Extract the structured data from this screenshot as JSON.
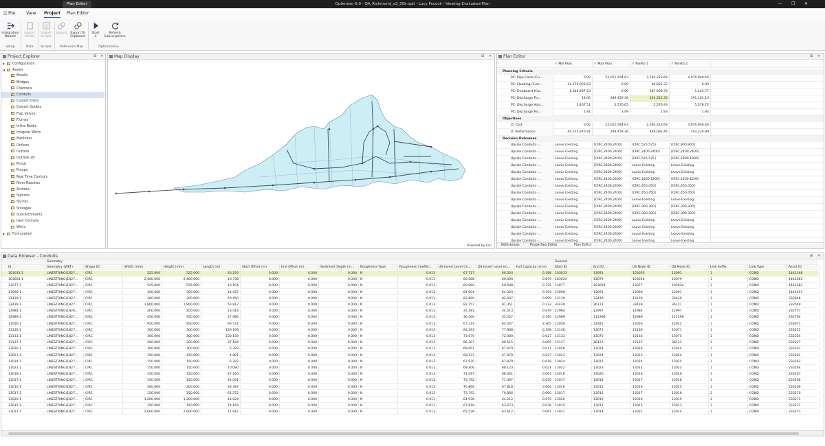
{
  "app": {
    "context_tab": "Plan Editor",
    "title": "Optimizer 6.0 - OA_Richmond_x3_50k.opti - Lucy Pocock - Viewing Evaluated Plan",
    "win_min": "—",
    "win_max": "❐",
    "win_close": "✕"
  },
  "menu": {
    "file": "File",
    "view": "View",
    "project": "Project",
    "plan_editor": "Plan Editor"
  },
  "ribbon": {
    "integration": "Integration\nModule",
    "import_model": "Import\nModel",
    "import_scripts": "Import\nScripts",
    "import": "Import",
    "export": "Export To\nClipboard",
    "start": "Start",
    "refresh": "Refresh\nSubscriptions",
    "groups": [
      "Setup",
      "Data",
      "Scripts",
      "Reference Map",
      "Optimization"
    ]
  },
  "explorer": {
    "title": "Project Explorer",
    "pin": "⊞",
    "close": "✕",
    "items": [
      {
        "label": "Configuration",
        "level": 0,
        "arrow": "▶"
      },
      {
        "label": "Assets",
        "level": 0,
        "arrow": "◢"
      },
      {
        "label": "Breaks",
        "level": 1
      },
      {
        "label": "Bridges",
        "level": 1
      },
      {
        "label": "Channels",
        "level": 1
      },
      {
        "label": "Conduits",
        "level": 1,
        "selected": true
      },
      {
        "label": "Culvert Inlets",
        "level": 1
      },
      {
        "label": "Culvert Outlets",
        "level": 1
      },
      {
        "label": "Flap Valves",
        "level": 1
      },
      {
        "label": "Flumes",
        "level": 1
      },
      {
        "label": "Inline Banks",
        "level": 1
      },
      {
        "label": "Irregular Weirs",
        "level": 1
      },
      {
        "label": "Manholes",
        "level": 1
      },
      {
        "label": "Orifices",
        "level": 1
      },
      {
        "label": "Outfalls",
        "level": 1
      },
      {
        "label": "Outfalls 2D",
        "level": 1
      },
      {
        "label": "Ponds",
        "level": 1
      },
      {
        "label": "Pumps",
        "level": 1
      },
      {
        "label": "Real Time Controls",
        "level": 1
      },
      {
        "label": "River Reaches",
        "level": 1
      },
      {
        "label": "Screens",
        "level": 1
      },
      {
        "label": "Siphons",
        "level": 1
      },
      {
        "label": "Sluices",
        "level": 1
      },
      {
        "label": "Storages",
        "level": 1
      },
      {
        "label": "Subcatchments",
        "level": 1
      },
      {
        "label": "User Controls",
        "level": 1
      },
      {
        "label": "Weirs",
        "level": 1
      },
      {
        "label": "Formulation",
        "level": 0,
        "arrow": "▶"
      }
    ]
  },
  "map": {
    "title": "Map Display",
    "credit": "Powered by Esri",
    "pin": "⊞",
    "close": "✕"
  },
  "plan_editor": {
    "title": "Plan Editor",
    "pin": "⊞",
    "close": "✕",
    "columns": [
      "Min Plan",
      "Max Plan",
      "Pareto 1",
      "Pareto 2"
    ],
    "sections": {
      "criteria": "Planning Criteria",
      "objectives": "Objectives",
      "decisions": "Decision Outcomes"
    },
    "criteria_rows": [
      {
        "label": "PC: Pipe Costs (Cu...",
        "v": [
          "0.00",
          "22,021,594.63",
          "2,594,323.69",
          "4,970,948.64"
        ]
      },
      {
        "label": "PC: Flooding (Curr...",
        "v": [
          "34,179,055.63",
          "0.00",
          "68,821.37",
          "0.00"
        ]
      },
      {
        "label": "PC: Freeboard (Cur...",
        "v": [
          "6,346,897.23",
          "0.00",
          "187,968.74",
          "1,445.77"
        ]
      },
      {
        "label": "PC: Discharge Flo...",
        "v": [
          "18.05",
          "349,459.36",
          "191,313.35",
          "191,181.13"
        ]
      },
      {
        "label": "PC: Discharge Volu...",
        "v": [
          "5,407.51",
          "5,570.05",
          "5,576.93",
          "5,578.72"
        ]
      },
      {
        "label": "PC: Discharge Flo...",
        "v": [
          "1.81",
          "3.49",
          "1.93",
          "1.92"
        ]
      }
    ],
    "objective_rows": [
      {
        "label": "O: Cost",
        "v": [
          "0.00",
          "22,021,594.63",
          "2,594,323.69",
          "4,970,948.64"
        ]
      },
      {
        "label": "O: Performance",
        "v": [
          "40,525,970.91",
          "349,459.36",
          "448,083.46",
          "193,226.89"
        ]
      }
    ],
    "decision_rows": [
      {
        "label": "Upsize Conduits -...",
        "v": [
          "Leave Existing",
          "[CIRC,2400,2400]",
          "[CIRC,525,525]",
          "[CIRC,900,900]"
        ]
      },
      {
        "label": "Upsize Conduits -...",
        "v": [
          "Leave Existing",
          "[CIRC,2400,2400]",
          "[CIRC,2400,2400]",
          "[CIRC,2400,2400]"
        ]
      },
      {
        "label": "Upsize Conduits -...",
        "v": [
          "Leave Existing",
          "[CIRC,2400,2400]",
          "[CIRC,525,525]",
          "[CIRC,1800,1800]"
        ]
      },
      {
        "label": "Upsize Conduits -...",
        "v": [
          "Leave Existing",
          "[CIRC,2400,2400]",
          "Leave Existing",
          "Leave Existing"
        ]
      },
      {
        "label": "Upsize Conduits -...",
        "v": [
          "Leave Existing",
          "[CIRC,2400,2400]",
          "Leave Existing",
          "Leave Existing"
        ]
      },
      {
        "label": "Upsize Conduits -...",
        "v": [
          "Leave Existing",
          "[CIRC,2400,2400]",
          "[CIRC,1800,1800]",
          "[CIRC,1200,1200]"
        ]
      },
      {
        "label": "Upsize Conduits -...",
        "v": [
          "Leave Existing",
          "[CIRC,2400,2400]",
          "[CIRC,450,450]",
          "[CIRC,450,450]"
        ]
      },
      {
        "label": "Upsize Conduits -...",
        "v": [
          "Leave Existing",
          "[CIRC,2400,2400]",
          "[CIRC,450,450]",
          "[CIRC,450,450]"
        ]
      },
      {
        "label": "Upsize Conduits -...",
        "v": [
          "Leave Existing",
          "[CIRC,2400,2400]",
          "Leave Existing",
          "Leave Existing"
        ]
      },
      {
        "label": "Upsize Conduits -...",
        "v": [
          "Leave Existing",
          "[CIRC,2400,2400]",
          "[CIRC,300,300]",
          "[CIRC,300,300]"
        ]
      },
      {
        "label": "Upsize Conduits -...",
        "v": [
          "Leave Existing",
          "[CIRC,2400,2400]",
          "[CIRC,300,300]",
          "[CIRC,300,300]"
        ]
      },
      {
        "label": "Upsize Conduits -...",
        "v": [
          "Leave Existing",
          "[CIRC,2400,2400]",
          "Leave Existing",
          "Leave Existing"
        ]
      },
      {
        "label": "Upsize Conduits -...",
        "v": [
          "Leave Existing",
          "[CIRC,2400,2400]",
          "Leave Existing",
          "Leave Existing"
        ]
      },
      {
        "label": "Upsize Conduits -...",
        "v": [
          "Leave Existing",
          "[CIRC,2400,2400]",
          "Leave Existing",
          "Leave Existing"
        ]
      },
      {
        "label": "Upsize Conduits -...",
        "v": [
          "Leave Existing",
          "[CIRC,2400,2400]",
          "Leave Existing",
          "Leave Existing"
        ]
      }
    ],
    "tabs": [
      "References",
      "Properties Editor",
      "Plan Editor"
    ]
  },
  "data_browser": {
    "title": "Data Browser - Conduits",
    "pin": "⊞",
    "close": "✕",
    "group_geometry": "Geometry",
    "group_general": "General",
    "columns": [
      "Id",
      "Geometry (WKT)",
      "Shape ID",
      "Width (mm)",
      "Height (mm)",
      "Length (m)",
      "Start Offset (m)",
      "End Offset (m)",
      "Sediment Depth (m...",
      "Roughness Type",
      "Roughness Coeffici...",
      "US Invert Level (m...",
      "DS Invert Level (m...",
      "Full Capacity (cms)",
      "Start ID",
      "End ID",
      "US Node ID",
      "DS Node ID",
      "Link Suffix",
      "Link Type",
      "Asset ID"
    ],
    "rows": [
      [
        "103033.1",
        "LINESTRING(1827...",
        "CIRC",
        "525.000",
        "525.000",
        "33.293",
        "0.000",
        "0.000",
        "0.000",
        "N",
        "0.013",
        "67.717",
        "66.324",
        "0.198",
        "103033",
        "13091",
        "103033",
        "13091",
        "1",
        "COND",
        "1441348"
      ],
      [
        "103024.1",
        "LINESTRING(1827...",
        "CIRC",
        "2,400.000",
        "2,400.000",
        "10.738",
        "0.000",
        "0.000",
        "0.000",
        "N",
        "0.013",
        "60.588",
        "60.004",
        "0.879",
        "103024",
        "13079",
        "103024",
        "13079",
        "1",
        "COND",
        "1441383"
      ],
      [
        "13077.1",
        "LINESTRING(1827...",
        "CIRC",
        "525.000",
        "525.000",
        "10.104",
        "0.000",
        "0.000",
        "0.000",
        "N",
        "0.013",
        "60.960",
        "60.588",
        "0.725",
        "13077",
        "103024",
        "13077",
        "103024",
        "1",
        "COND",
        "1441383"
      ],
      [
        "13090.1",
        "LINESTRING(1827...",
        "CIRC",
        "300.000",
        "300.000",
        "14.457",
        "0.000",
        "0.000",
        "0.000",
        "N",
        "0.013",
        "64.904",
        "64.324",
        "0.194",
        "13090",
        "13091",
        "13090",
        "13091",
        "1",
        "COND",
        "1441453"
      ],
      [
        "13139.1",
        "LINESTRING(1827...",
        "CIRC",
        "300.000",
        "300.000",
        "50.450",
        "0.000",
        "0.000",
        "0.000",
        "N",
        "0.013",
        "82.890",
        "82.097",
        "0.099",
        "13139",
        "33439",
        "13139",
        "33439",
        "1",
        "COND",
        "232048"
      ],
      [
        "33439.1",
        "LINESTRING(1827...",
        "CIRC",
        "1,800.000",
        "1,800.000",
        "53.812",
        "0.000",
        "0.000",
        "0.000",
        "N",
        "0.013",
        "82.357",
        "81.351",
        "0.132",
        "33439",
        "36121",
        "33439",
        "36121",
        "1",
        "COND",
        "232049"
      ],
      [
        "12984.1",
        "LINESTRING(1826...",
        "CIRC",
        "200.000",
        "200.000",
        "13.414",
        "0.000",
        "0.000",
        "0.000",
        "N",
        "0.013",
        "35.281",
        "34.513",
        "0.079",
        "12984",
        "12997",
        "12984",
        "12997",
        "1",
        "COND",
        "232757"
      ],
      [
        "12989.1",
        "LINESTRING(1827...",
        "CIRC",
        "450.000",
        "450.000",
        "17.980",
        "0.000",
        "0.000",
        "0.000",
        "N",
        "0.013",
        "36.500",
        "35.357",
        "0.190",
        "12989",
        "111396",
        "12989",
        "111396",
        "1",
        "COND",
        "232764"
      ],
      [
        "13056.1",
        "LINESTRING(1827...",
        "CIRC",
        "950.000",
        "950.000",
        "93.571",
        "0.000",
        "0.000",
        "0.000",
        "N",
        "0.013",
        "67.214",
        "64.037",
        "2.365",
        "13056",
        "12922",
        "13056",
        "12922",
        "1",
        "COND",
        "233071"
      ],
      [
        "13136.1",
        "LINESTRING(1827...",
        "CIRC",
        "300.000",
        "300.000",
        "129.199",
        "0.000",
        "0.000",
        "0.000",
        "N",
        "0.013",
        "83.393",
        "77.968",
        "0.198",
        "13136",
        "13071",
        "13136",
        "13071",
        "1",
        "COND",
        "233225"
      ],
      [
        "13133.1",
        "LINESTRING(1827...",
        "CIRC",
        "300.000",
        "300.000",
        "130.159",
        "0.000",
        "0.000",
        "0.000",
        "N",
        "0.013",
        "73.670",
        "72.000",
        "0.027",
        "13133",
        "13075",
        "13133",
        "13075",
        "1",
        "COND",
        "232224"
      ],
      [
        "13137.1",
        "LINESTRING(1827...",
        "CIRC",
        "200.000",
        "200.000",
        "37.184",
        "0.000",
        "0.000",
        "0.000",
        "N",
        "0.013",
        "86.207",
        "80.515",
        "0.065",
        "13137",
        "36123",
        "13137",
        "36123",
        "1",
        "COND",
        "232227"
      ],
      [
        "13026.1",
        "LINESTRING(1827...",
        "CIRC",
        "300.000",
        "300.000",
        "5.392",
        "0.000",
        "0.000",
        "0.000",
        "N",
        "0.013",
        "68.001",
        "67.970",
        "0.011",
        "13026",
        "13024",
        "13026",
        "13024",
        "1",
        "COND",
        "233261"
      ],
      [
        "13023.1",
        "LINESTRING(1827...",
        "CIRC",
        "150.000",
        "150.000",
        "4.801",
        "0.000",
        "0.000",
        "0.000",
        "N",
        "0.013",
        "68.123",
        "67.970",
        "0.027",
        "13023",
        "13024",
        "13023",
        "13024",
        "1",
        "COND",
        "233262"
      ],
      [
        "13024.1",
        "LINESTRING(1827...",
        "CIRC",
        "150.000",
        "150.000",
        "6.282",
        "0.000",
        "0.000",
        "0.000",
        "N",
        "0.013",
        "67.970",
        "67.879",
        "0.018",
        "13024",
        "13025",
        "13024",
        "13025",
        "1",
        "COND",
        "233263"
      ],
      [
        "13022.1",
        "LINESTRING(1827...",
        "CIRC",
        "150.000",
        "150.000",
        "10.080",
        "0.000",
        "0.000",
        "0.000",
        "N",
        "0.013",
        "68.306",
        "68.123",
        "0.021",
        "13022",
        "13023",
        "13022",
        "13023",
        "1",
        "COND",
        "233264"
      ],
      [
        "13018.1",
        "LINESTRING(1827...",
        "CIRC",
        "150.000",
        "150.000",
        "47.160",
        "0.000",
        "0.000",
        "0.000",
        "N",
        "0.013",
        "71.497",
        "68.001",
        "0.061",
        "13018",
        "13026",
        "13018",
        "13026",
        "1",
        "COND",
        "233267"
      ],
      [
        "13017.1",
        "LINESTRING(1827...",
        "CIRC",
        "150.000",
        "150.000",
        "44.041",
        "0.000",
        "0.000",
        "0.000",
        "N",
        "0.013",
        "73.792",
        "71.497",
        "0.035",
        "13017",
        "13018",
        "13017",
        "13018",
        "1",
        "COND",
        "233268"
      ],
      [
        "13016.1",
        "LINESTRING(1827...",
        "CIRC",
        "300.000",
        "300.000",
        "36.387",
        "0.000",
        "0.000",
        "0.000",
        "N",
        "0.013",
        "70.866",
        "67.818",
        "0.064",
        "13016",
        "13015",
        "13016",
        "13015",
        "1",
        "COND",
        "233269"
      ],
      [
        "13017.2",
        "LINESTRING(1827...",
        "CIRC",
        "150.000",
        "150.000",
        "61.572",
        "0.000",
        "0.000",
        "0.000",
        "N",
        "0.013",
        "73.792",
        "70.866",
        "0.060",
        "13017",
        "13016",
        "13017",
        "13016",
        "2",
        "COND",
        "233270"
      ],
      [
        "13020.1",
        "LINESTRING(1827...",
        "CIRC",
        "1,200.000",
        "1,200.000",
        "14.024",
        "0.000",
        "0.000",
        "0.000",
        "N",
        "0.013",
        "64.938",
        "64.212",
        "0.075",
        "13020",
        "13019",
        "13020",
        "13019",
        "1",
        "COND",
        "233271"
      ],
      [
        "13015.1",
        "LINESTRING(1827...",
        "CIRC",
        "150.000",
        "150.000",
        "74.169",
        "0.000",
        "0.000",
        "0.000",
        "N",
        "0.013",
        "67.818",
        "63.673",
        "0.036",
        "13015",
        "13013",
        "13015",
        "13013",
        "1",
        "COND",
        "233272"
      ],
      [
        "13021.1",
        "LINESTRING(1827...",
        "CIRC",
        "2,600.000",
        "2,600.000",
        "11.912",
        "0.000",
        "0.000",
        "0.000",
        "N",
        "0.013",
        "65.538",
        "63.612",
        "0.061",
        "13021",
        "13014",
        "13021",
        "13014",
        "1",
        "COND",
        "233273"
      ]
    ]
  },
  "colors": {
    "accent": "#2a5caa",
    "map_fill": "#cdeef5",
    "map_line": "#3d4a5c",
    "selection": "#d8e4f5",
    "highlight": "#eef2c8"
  },
  "icons": {
    "file": "menu-icon",
    "integration": "integration-icon",
    "start": "play-icon",
    "refresh": "refresh-icon"
  }
}
